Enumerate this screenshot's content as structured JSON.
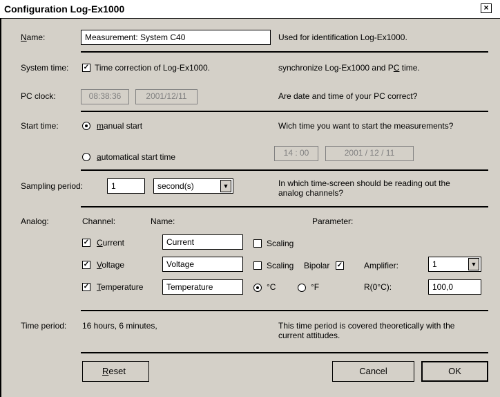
{
  "window": {
    "title": "Configuration Log-Ex1000",
    "close_label": "×"
  },
  "name_row": {
    "label_accel": "N",
    "label_rest": "ame:",
    "value": "Measurement: System C40",
    "hint": "Used for identification Log-Ex1000."
  },
  "system_time": {
    "label": "System time:",
    "checkbox_label": "Time correction of Log-Ex1000.",
    "checked": true,
    "hint_pre": "synchronize Log-Ex1000 and P",
    "hint_accel": "C",
    "hint_post": " time."
  },
  "pc_clock": {
    "label": "PC clock:",
    "time": "08:38:36",
    "date": "2001/12/11",
    "hint": "Are date and time of your PC correct?"
  },
  "start_time": {
    "label": "Start time:",
    "manual_accel": "m",
    "manual_rest": "anual start",
    "auto_accel": "a",
    "auto_rest": "utomatical start time",
    "hint": "Wich time you want to start the measurements?",
    "auto_time": "14 : 00",
    "auto_date": "2001  /  12  /  11",
    "selected": "manual"
  },
  "sampling": {
    "label": "Sampling period:",
    "value": "1",
    "unit": "second(s)",
    "hint_line1": "In which time-screen should be reading out the",
    "hint_line2": "analog channels?"
  },
  "analog": {
    "label": "Analog:",
    "col_channel": "Channel:",
    "col_name": "Name:",
    "col_parameter": "Parameter:",
    "channels": [
      {
        "accel": "C",
        "rest": "urrent",
        "name": "Current",
        "checked": true
      },
      {
        "accel": "V",
        "rest": "oltage",
        "name": "Voltage",
        "checked": true
      },
      {
        "accel": "T",
        "rest": "emperature",
        "name": "Temperature",
        "checked": true
      }
    ],
    "scaling_label": "Scaling",
    "bipolar_label": "Bipolar",
    "amplifier_label": "Amplifier:",
    "amplifier_value": "1",
    "unit_c": "°C",
    "unit_f": "°F",
    "r0_label": "R(0°C):",
    "r0_value": "100,0"
  },
  "time_period": {
    "label": "Time period:",
    "value": "16 hours, 6 minutes,",
    "hint_line1": "This time period is covered theoretically with the",
    "hint_line2": "current attitudes."
  },
  "buttons": {
    "reset_accel": "R",
    "reset_rest": "eset",
    "cancel": "Cancel",
    "ok": "OK"
  }
}
